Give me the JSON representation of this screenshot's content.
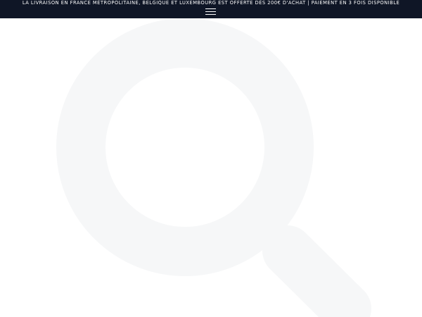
{
  "announcement": {
    "text": "LA LIVRAISON EN FRANCE MÉTROPOLITAINE, BELGIQUE ET LUXEMBOURG EST OFFERTE DÈS 200€ D'ACHAT | PAIEMENT EN 3 FOIS DISPONIBLE"
  },
  "header": {
    "menu_icon": "hamburger-menu-icon"
  },
  "content": {
    "background_icon": "magnifier-icon"
  },
  "colors": {
    "announcement_background": "#0f1626",
    "announcement_text": "#ffffff",
    "page_background": "#ffffff",
    "illustration": "#f6f7f8"
  }
}
